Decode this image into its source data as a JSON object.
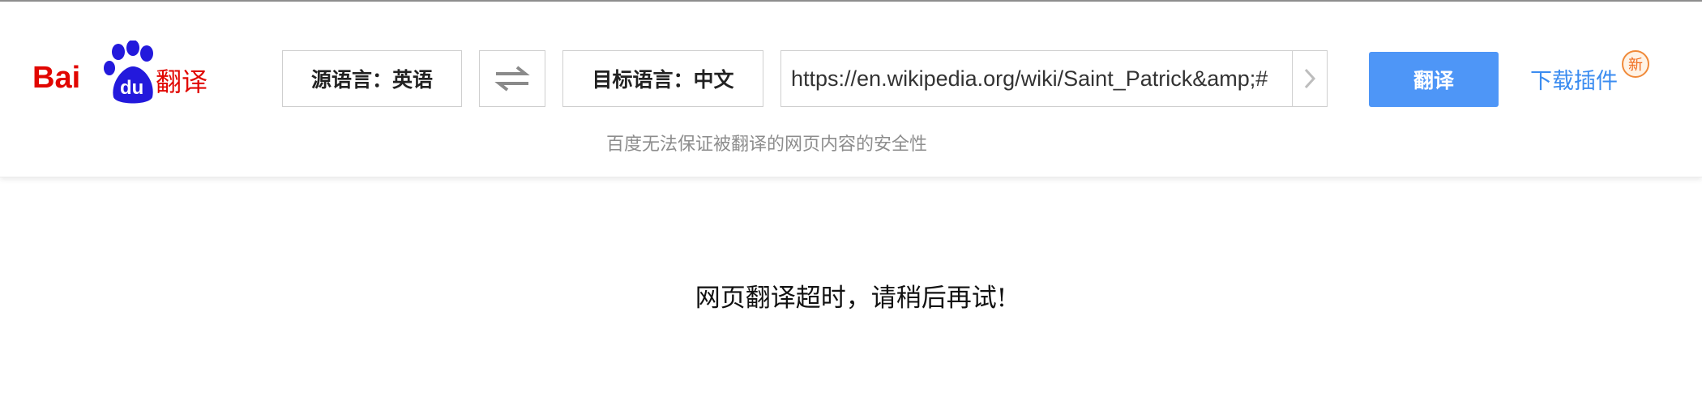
{
  "brand": {
    "logo_text_bai": "Bai",
    "logo_text_du": "du",
    "logo_text_cn": "翻译",
    "colors": {
      "red": "#e10601",
      "blue": "#2319dc"
    }
  },
  "toolbar": {
    "source_language": "源语言：英语",
    "target_language": "目标语言：中文",
    "swap_icon": "swap-arrows-icon",
    "url_value": "https://en.wikipedia.org/wiki/Saint_Patrick&amp;#",
    "go_icon": "chevron-right-icon",
    "translate_label": "翻译",
    "plugin_label": "下载插件",
    "new_badge": "新",
    "disclaimer": "百度无法保证被翻译的网页内容的安全性",
    "accent_color": "#4e96f7"
  },
  "main": {
    "message": "网页翻译超时，请稍后再试!"
  }
}
